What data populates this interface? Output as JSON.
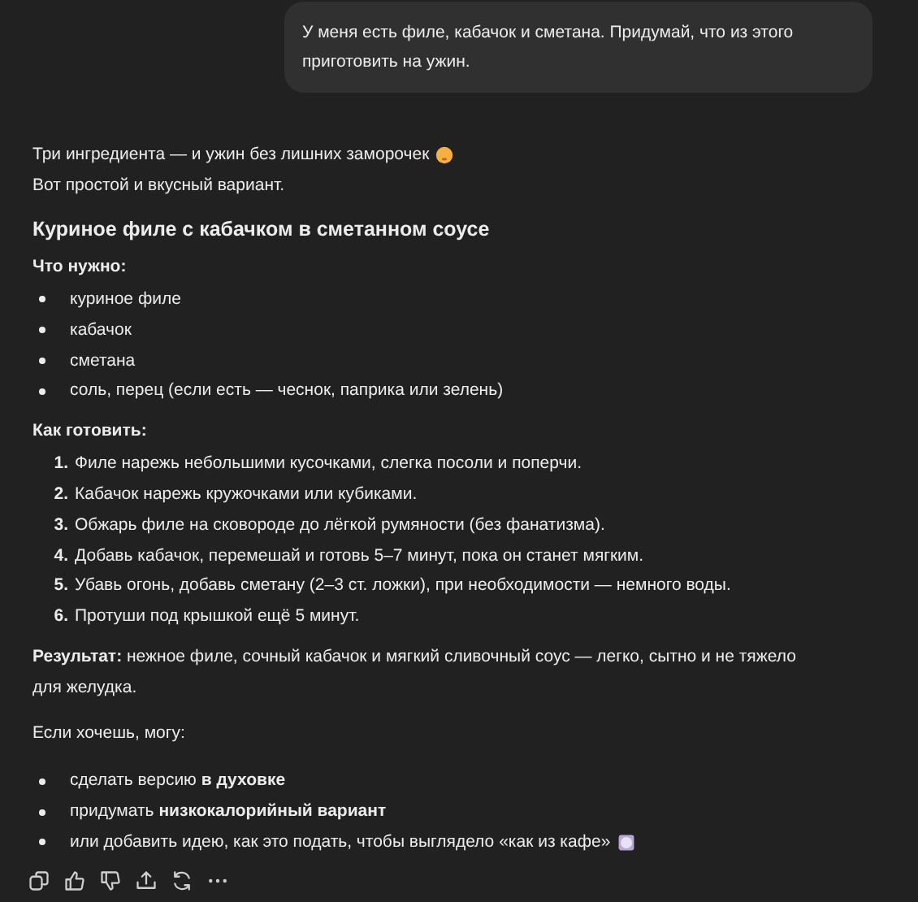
{
  "user_message": {
    "text": "У меня есть филе, кабачок и сметана. Придумай, что из этого приготовить на ужин."
  },
  "response": {
    "blocks": [
      {
        "kind": "paragraph",
        "lines": [
          "Три ингредиента — и ужин без лишних заморочек",
          "Вот простой и вкусный вариант."
        ],
        "trailing_icon": {
          "kind": "relieved"
        }
      },
      {
        "kind": "heading",
        "text": "Куриное филе с кабачком в сметанном соусе"
      },
      {
        "kind": "label",
        "text": "Что нужно:"
      },
      {
        "kind": "bullets",
        "items": [
          "куриное филе",
          "кабачок",
          "сметана",
          "соль, перец (если есть — чеснок, паприка или зелень)"
        ]
      },
      {
        "kind": "label",
        "text": "Как готовить:"
      },
      {
        "kind": "numbered",
        "items": [
          {
            "number": "1.",
            "text": "Филе нарежь небольшими кусочками, слегка посоли и поперчи."
          },
          {
            "number": "2.",
            "text": "Кабачок нарежь кружочками или кубиками."
          },
          {
            "number": "3.",
            "text": "Обжарь филе на сковороде до лёгкой румяности (без фанатизма)."
          },
          {
            "number": "4.",
            "text": "Добавь кабачок, перемешай и готовь 5–7 минут, пока он станет мягким."
          },
          {
            "number": "5.",
            "text": "Убавь огонь, добавь сметану (2–3 ст. ложки), при необходимости — немного воды."
          },
          {
            "number": "6.",
            "text": "Протуши под крышкой ещё 5 минут."
          }
        ]
      },
      {
        "kind": "result",
        "text": "**Результат:** нежное филе, сочный кабачок и мягкий сливочный соус — легко, сытно и не тяжело для желудка."
      },
      {
        "kind": "paragraph",
        "lines": [
          "Если хочешь, могу:"
        ]
      },
      {
        "kind": "bullets",
        "items": [
          "сделать версию **в духовке**",
          "придумать **низкокалорийный вариант**",
          "или добавить идею, как это подать, чтобы выглядело «как из кафе»"
        ],
        "trailing_icon": {
          "kind": "plate"
        }
      }
    ]
  },
  "actions": [
    {
      "kind": "copy"
    },
    {
      "kind": "like"
    },
    {
      "kind": "dislike"
    },
    {
      "kind": "share"
    },
    {
      "kind": "regenerate"
    },
    {
      "kind": "more"
    }
  ]
}
